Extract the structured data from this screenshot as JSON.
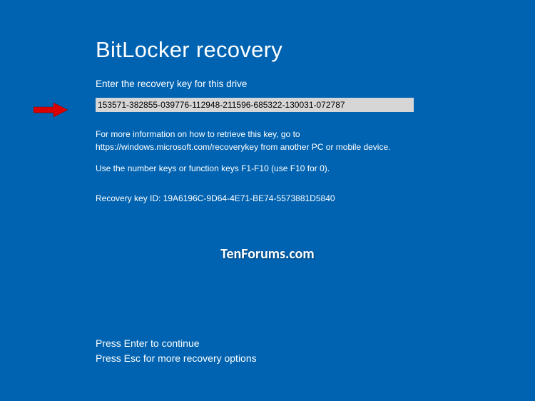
{
  "title": "BitLocker recovery",
  "subtitle": "Enter the recovery key for this drive",
  "key_input": {
    "value": "153571-382855-039776-112948-211596-685322-130031-072787"
  },
  "info": {
    "line1": "For more information on how to retrieve this key, go to",
    "line2": "https://windows.microsoft.com/recoverykey from another PC or mobile device."
  },
  "function_keys_hint": "Use the number keys or function keys F1-F10 (use F10 for 0).",
  "recovery_id_label": "Recovery key ID: 19A6196C-9D64-4E71-BE74-5573881D5840",
  "watermark": "TenForums.com",
  "prompts": {
    "enter": "Press Enter to continue",
    "esc": "Press Esc for more recovery options"
  },
  "colors": {
    "background": "#0063b1",
    "text": "#ffffff",
    "input_bg": "#d6d6d6",
    "arrow": "#d80000"
  }
}
